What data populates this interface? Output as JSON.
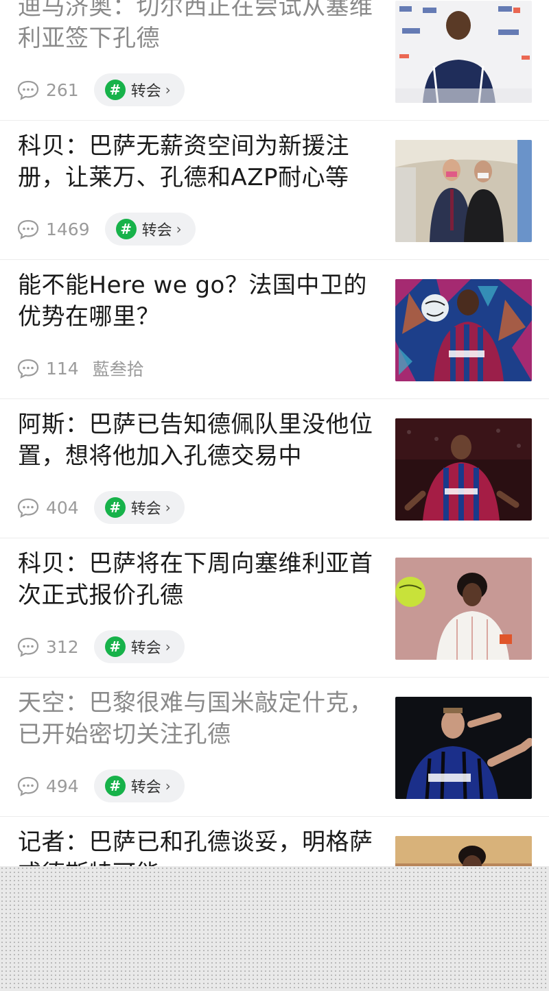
{
  "feed": {
    "items": [
      {
        "title": "迪马济奥：切尔西正在尝试从塞维利亚签下孔德",
        "comments": "261",
        "tag": "转会",
        "author": "",
        "read": true
      },
      {
        "title": "科贝：巴萨无薪资空间为新援注册，让莱万、孔德和AZP耐心等",
        "comments": "1469",
        "tag": "转会",
        "author": "",
        "read": false
      },
      {
        "title": "能不能Here we go？法国中卫的优势在哪里？",
        "comments": "114",
        "tag": "",
        "author": "藍叁拾",
        "read": false
      },
      {
        "title": "阿斯：巴萨已告知德佩队里没他位置，想将他加入孔德交易中",
        "comments": "404",
        "tag": "转会",
        "author": "",
        "read": false
      },
      {
        "title": "科贝：巴萨将在下周向塞维利亚首次正式报价孔德",
        "comments": "312",
        "tag": "转会",
        "author": "",
        "read": false
      },
      {
        "title": "天空：巴黎很难与国米敲定什克，已开始密切关注孔德",
        "comments": "494",
        "tag": "转会",
        "author": "",
        "read": true
      },
      {
        "title": "记者：巴萨已和孔德谈妥，明格萨或德斯特可能",
        "comments": "",
        "tag": "",
        "author": "",
        "read": false
      }
    ]
  }
}
